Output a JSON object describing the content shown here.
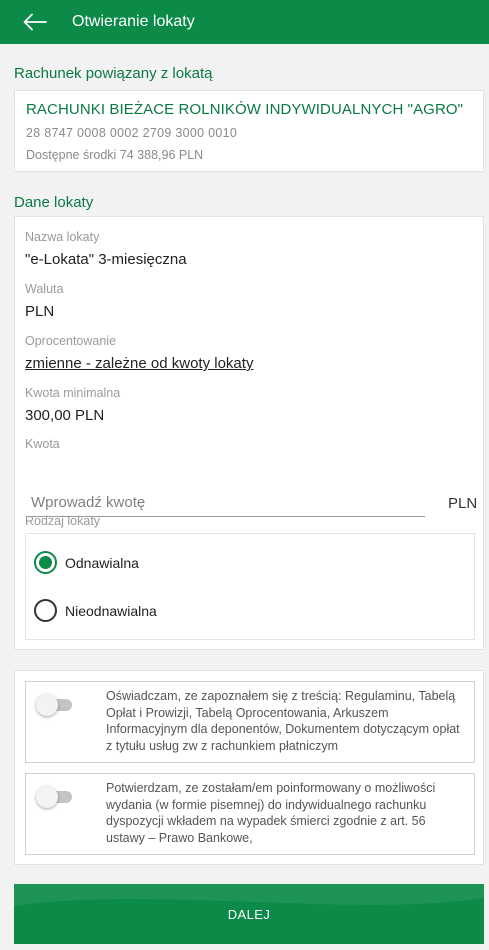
{
  "header": {
    "title": "Otwieranie lokaty"
  },
  "linked_account": {
    "section_title": "Rachunek powiązany z lokatą",
    "name": "RACHUNKI BIEŻACE ROLNIKÓW INDYWIDUALNYCH \"AGRO\"",
    "number": "28 8747 0008 0002 2709 3000 0010",
    "funds": "Dostępne środki 74 388,96 PLN"
  },
  "deposit": {
    "section_title": "Dane lokaty",
    "name_label": "Nazwa lokaty",
    "name_value": "\"e-Lokata\" 3-miesięczna",
    "currency_label": "Waluta",
    "currency_value": "PLN",
    "interest_label": "Oprocentowanie",
    "interest_value": "zmienne - zależne od kwoty lokaty",
    "min_amount_label": "Kwota minimalna",
    "min_amount_value": "300,00 PLN",
    "amount_label": "Kwota",
    "amount_placeholder": "Wprowadź kwotę",
    "amount_value": "",
    "amount_currency": "PLN",
    "type_label": "Rodzaj lokaty",
    "type_options": [
      {
        "label": "Odnawialna",
        "selected": true
      },
      {
        "label": "Nieodnawialna",
        "selected": false
      }
    ]
  },
  "consents": [
    {
      "text": "Oświadczam, ze zapoznałem się z treścią: Regulaminu, Tabelą Opłat i Prowizji, Tabelą Oprocentowania, Arkuszem Informacyjnym dla deponentów, Dokumentem dotyczącym opłat z tytułu usług zw z rachunkiem płatniczym",
      "checked": false
    },
    {
      "text": "Potwierdzam, ze zostałam/em poinformowany o możliwości wydania (w formie pisemnej) do indywidualnego rachunku dyspozycji wkładem na wypadek śmierci zgodnie z  art. 56 ustawy – Prawo Bankowe,",
      "checked": false
    }
  ],
  "footer": {
    "next_label": "DALEJ"
  },
  "colors": {
    "brand_green": "#0b8a48",
    "section_title_green": "#0b7a42",
    "background": "#f2f2f2"
  },
  "icons": {
    "back": "arrow-left-icon"
  }
}
